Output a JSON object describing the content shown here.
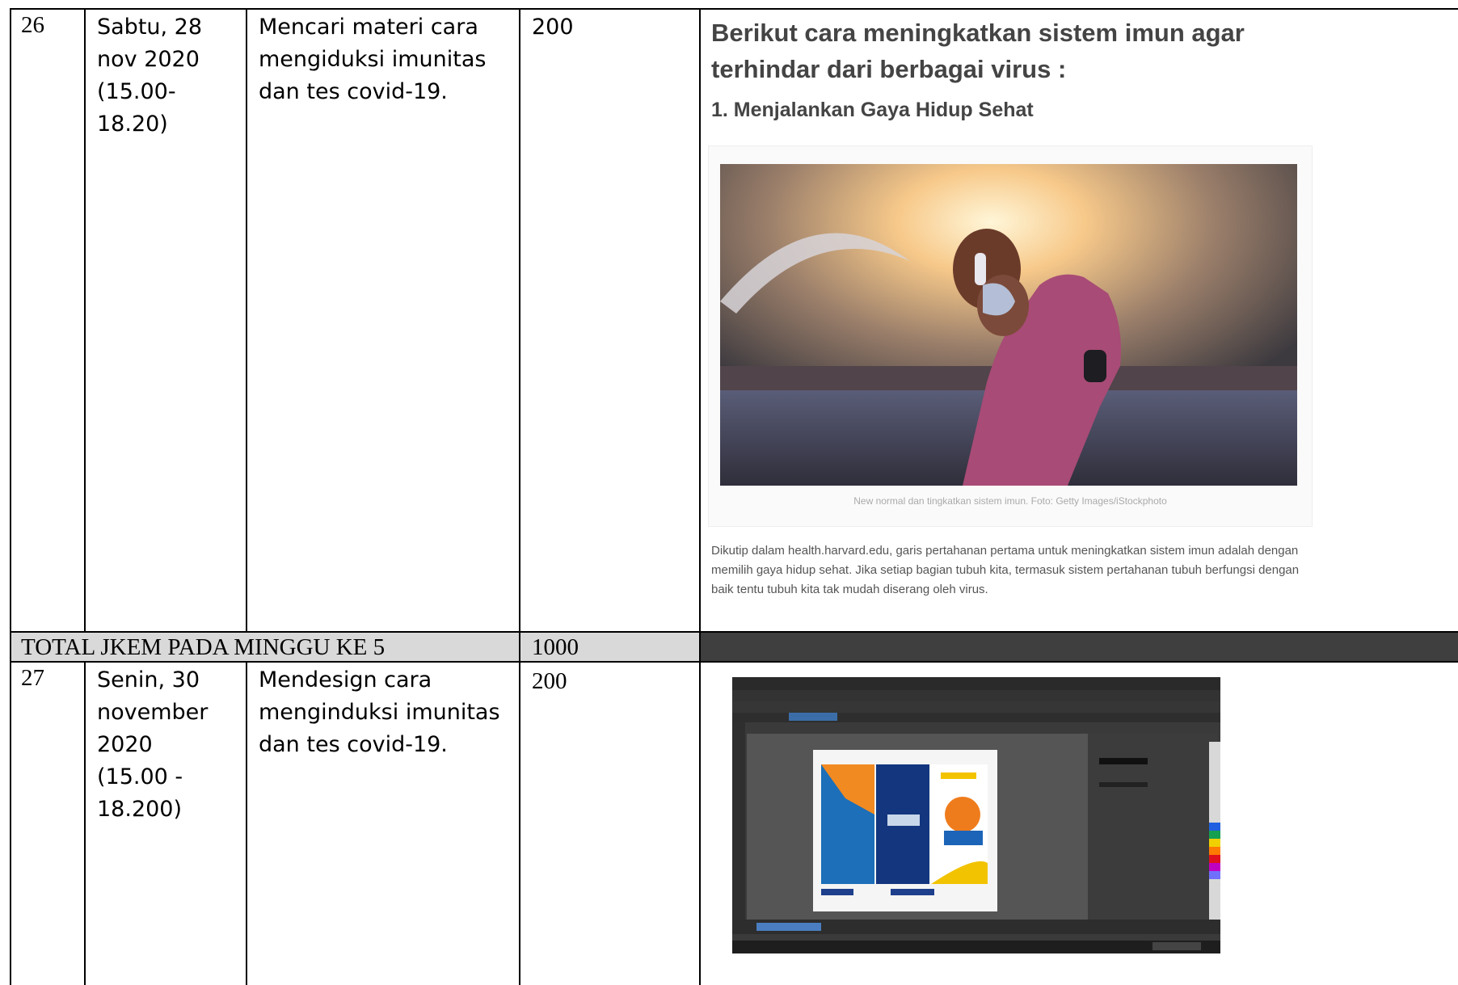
{
  "row26": {
    "no": "26",
    "date": "Sabtu, 28\nnov 2020\n(15.00-\n18.20)",
    "activity": "Mencari materi cara\nmengiduksi imunitas\ndan tes covid-19.",
    "jkem": "200"
  },
  "article": {
    "heading": "Berikut cara meningkatkan sistem imun agar terhindar dari berbagai virus :",
    "subheading": "1. Menjalankan Gaya Hidup Sehat",
    "caption": "New normal dan tingkatkan sistem imun. Foto: Getty Images/iStockphoto",
    "paragraph": "Dikutip dalam health.harvard.edu, garis pertahanan pertama untuk meningkatkan sistem imun adalah dengan memilih gaya hidup sehat. Jika setiap bagian tubuh kita, termasuk sistem pertahanan tubuh berfungsi dengan baik tentu tubuh kita tak mudah diserang oleh virus."
  },
  "total": {
    "label": "TOTAL JKEM PADA MINGGU KE 5",
    "value": "1000"
  },
  "row27": {
    "no": "27",
    "date": "Senin, 30\nnovember\n2020\n(15.00 -\n18.200)",
    "activity": "Mendesign cara\nmenginduksi imunitas\ndan tes covid-19.",
    "jkem": "200"
  },
  "colors": {
    "total_band": "#d9d9d9",
    "dark_band": "#3f3f3f",
    "border": "#000000"
  }
}
